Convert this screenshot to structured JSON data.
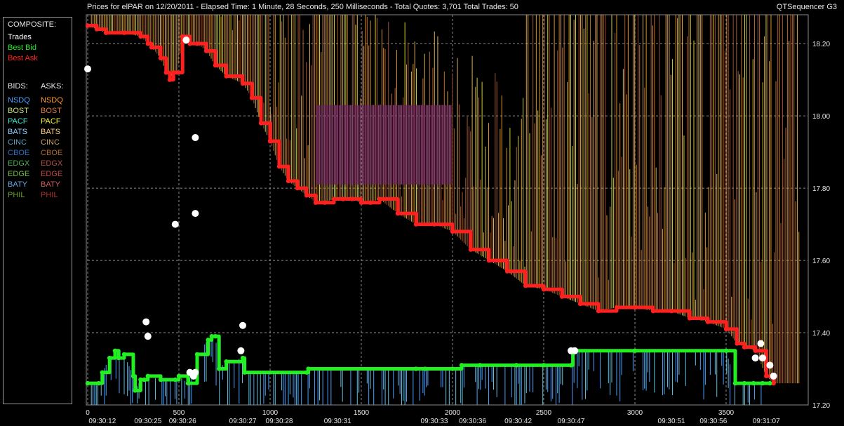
{
  "header": {
    "title": "Prices for  elPAR  on  12/20/2011  -  Elapsed Time: 1 Minute, 28 Seconds, 250 Milliseconds  -  Total Quotes: 3,701  Total Trades: 50",
    "app_name": "QTSequencer G3"
  },
  "legend": {
    "composite_label": "COMPOSITE:",
    "composite": [
      {
        "label": "Trades",
        "color": "#ffffff"
      },
      {
        "label": "Best Bid",
        "color": "#22ee22"
      },
      {
        "label": "Best Ask",
        "color": "#ff2020"
      }
    ],
    "bids_label": "BIDS:",
    "asks_label": "ASKS:",
    "exchanges": [
      {
        "bid": "NSDQ",
        "ask": "NSDQ",
        "bid_color": "#4aa0ff",
        "ask_color": "#ff9a2a"
      },
      {
        "bid": "BOST",
        "ask": "BOST",
        "bid_color": "#c8e070",
        "ask_color": "#e07840"
      },
      {
        "bid": "PACF",
        "ask": "PACF",
        "bid_color": "#40e8d0",
        "ask_color": "#f0f040"
      },
      {
        "bid": "BATS",
        "ask": "BATS",
        "bid_color": "#90d0ff",
        "ask_color": "#ffd080"
      },
      {
        "bid": "CINC",
        "ask": "CINC",
        "bid_color": "#60a0c0",
        "ask_color": "#c8a060"
      },
      {
        "bid": "CBOE",
        "ask": "CBOE",
        "bid_color": "#3070c0",
        "ask_color": "#b06a30"
      },
      {
        "bid": "EDGX",
        "ask": "EDGX",
        "bid_color": "#50b050",
        "ask_color": "#b05040"
      },
      {
        "bid": "EDGE",
        "ask": "EDGE",
        "bid_color": "#70c040",
        "ask_color": "#c04848"
      },
      {
        "bid": "BATY",
        "ask": "BATY",
        "bid_color": "#6aa8e8",
        "ask_color": "#d06060"
      },
      {
        "bid": "PHIL",
        "ask": "PHIL",
        "bid_color": "#70a030",
        "ask_color": "#b03030"
      }
    ]
  },
  "chart_data": {
    "type": "line",
    "x_label": "",
    "y_label": "",
    "xlim": [
      0,
      3950
    ],
    "ylim": [
      17.2,
      18.28
    ],
    "grid": true,
    "x_ticks": [
      0,
      500,
      1000,
      1500,
      2000,
      2500,
      3000,
      3500
    ],
    "y_ticks": [
      17.2,
      17.4,
      17.6,
      17.8,
      18.0,
      18.2
    ],
    "time_labels": [
      {
        "x": 80,
        "label": "09:30:12"
      },
      {
        "x": 330,
        "label": "09:30:25"
      },
      {
        "x": 520,
        "label": "09:30:26"
      },
      {
        "x": 850,
        "label": "09:30:27"
      },
      {
        "x": 1050,
        "label": "09:30:28"
      },
      {
        "x": 1370,
        "label": "09:30:31"
      },
      {
        "x": 1900,
        "label": "09:30:33"
      },
      {
        "x": 2110,
        "label": "09:30:36"
      },
      {
        "x": 2360,
        "label": "09:30:42"
      },
      {
        "x": 2650,
        "label": "09:30:47"
      },
      {
        "x": 3200,
        "label": "09:30:51"
      },
      {
        "x": 3430,
        "label": "09:30:56"
      },
      {
        "x": 3720,
        "label": "09:31:07"
      }
    ],
    "series": [
      {
        "name": "Best Ask",
        "color": "#ff2020",
        "x": [
          0,
          50,
          100,
          200,
          290,
          330,
          350,
          400,
          430,
          450,
          470,
          490,
          520,
          560,
          600,
          650,
          700,
          760,
          850,
          900,
          950,
          1000,
          1050,
          1100,
          1150,
          1200,
          1250,
          1300,
          1350,
          1400,
          1450,
          1500,
          1550,
          1600,
          1700,
          1800,
          1900,
          2000,
          2100,
          2200,
          2300,
          2400,
          2500,
          2600,
          2700,
          2800,
          2900,
          3000,
          3100,
          3200,
          3300,
          3400,
          3500,
          3560,
          3600,
          3660,
          3720,
          3760
        ],
        "y": [
          18.25,
          18.24,
          18.23,
          18.23,
          18.22,
          18.2,
          18.19,
          18.16,
          18.12,
          18.1,
          18.12,
          18.12,
          18.22,
          18.2,
          18.2,
          18.18,
          18.14,
          18.11,
          18.09,
          18.05,
          17.98,
          17.93,
          17.86,
          17.82,
          17.8,
          17.78,
          17.76,
          17.76,
          17.77,
          17.77,
          17.77,
          17.76,
          17.76,
          17.77,
          17.73,
          17.7,
          17.7,
          17.68,
          17.63,
          17.6,
          17.57,
          17.53,
          17.52,
          17.5,
          17.48,
          17.46,
          17.47,
          17.47,
          17.46,
          17.46,
          17.44,
          17.43,
          17.41,
          17.37,
          17.36,
          17.35,
          17.28,
          17.26
        ]
      },
      {
        "name": "Best Bid",
        "color": "#22ee22",
        "x": [
          0,
          60,
          80,
          120,
          150,
          170,
          200,
          250,
          260,
          290,
          310,
          330,
          400,
          480,
          500,
          550,
          600,
          660,
          680,
          700,
          720,
          760,
          850,
          860,
          1200,
          1210,
          1800,
          1850,
          2000,
          2050,
          2150,
          2350,
          2500,
          2650,
          2660,
          3000,
          3500,
          3550,
          3600,
          3650,
          3700,
          3740
        ],
        "y": [
          17.26,
          17.26,
          17.29,
          17.33,
          17.35,
          17.33,
          17.34,
          17.28,
          17.24,
          17.27,
          17.27,
          17.28,
          17.27,
          17.27,
          17.28,
          17.26,
          17.34,
          17.38,
          17.39,
          17.39,
          17.3,
          17.32,
          17.33,
          17.29,
          17.29,
          17.3,
          17.3,
          17.3,
          17.3,
          17.31,
          17.31,
          17.31,
          17.31,
          17.31,
          17.35,
          17.35,
          17.35,
          17.26,
          17.26,
          17.26,
          17.26,
          17.26
        ]
      }
    ],
    "trades": [
      {
        "x": 0,
        "y": 18.13
      },
      {
        "x": 540,
        "y": 18.21
      },
      {
        "x": 590,
        "y": 17.94
      },
      {
        "x": 480,
        "y": 17.7
      },
      {
        "x": 590,
        "y": 17.73
      },
      {
        "x": 320,
        "y": 17.43
      },
      {
        "x": 330,
        "y": 17.39
      },
      {
        "x": 850,
        "y": 17.42
      },
      {
        "x": 840,
        "y": 17.35
      },
      {
        "x": 560,
        "y": 17.29
      },
      {
        "x": 580,
        "y": 17.28
      },
      {
        "x": 590,
        "y": 17.29
      },
      {
        "x": 2650,
        "y": 17.35
      },
      {
        "x": 2670,
        "y": 17.35
      },
      {
        "x": 3660,
        "y": 17.33
      },
      {
        "x": 3690,
        "y": 17.37
      },
      {
        "x": 3700,
        "y": 17.33
      },
      {
        "x": 3740,
        "y": 17.31
      },
      {
        "x": 3760,
        "y": 17.28
      }
    ]
  }
}
